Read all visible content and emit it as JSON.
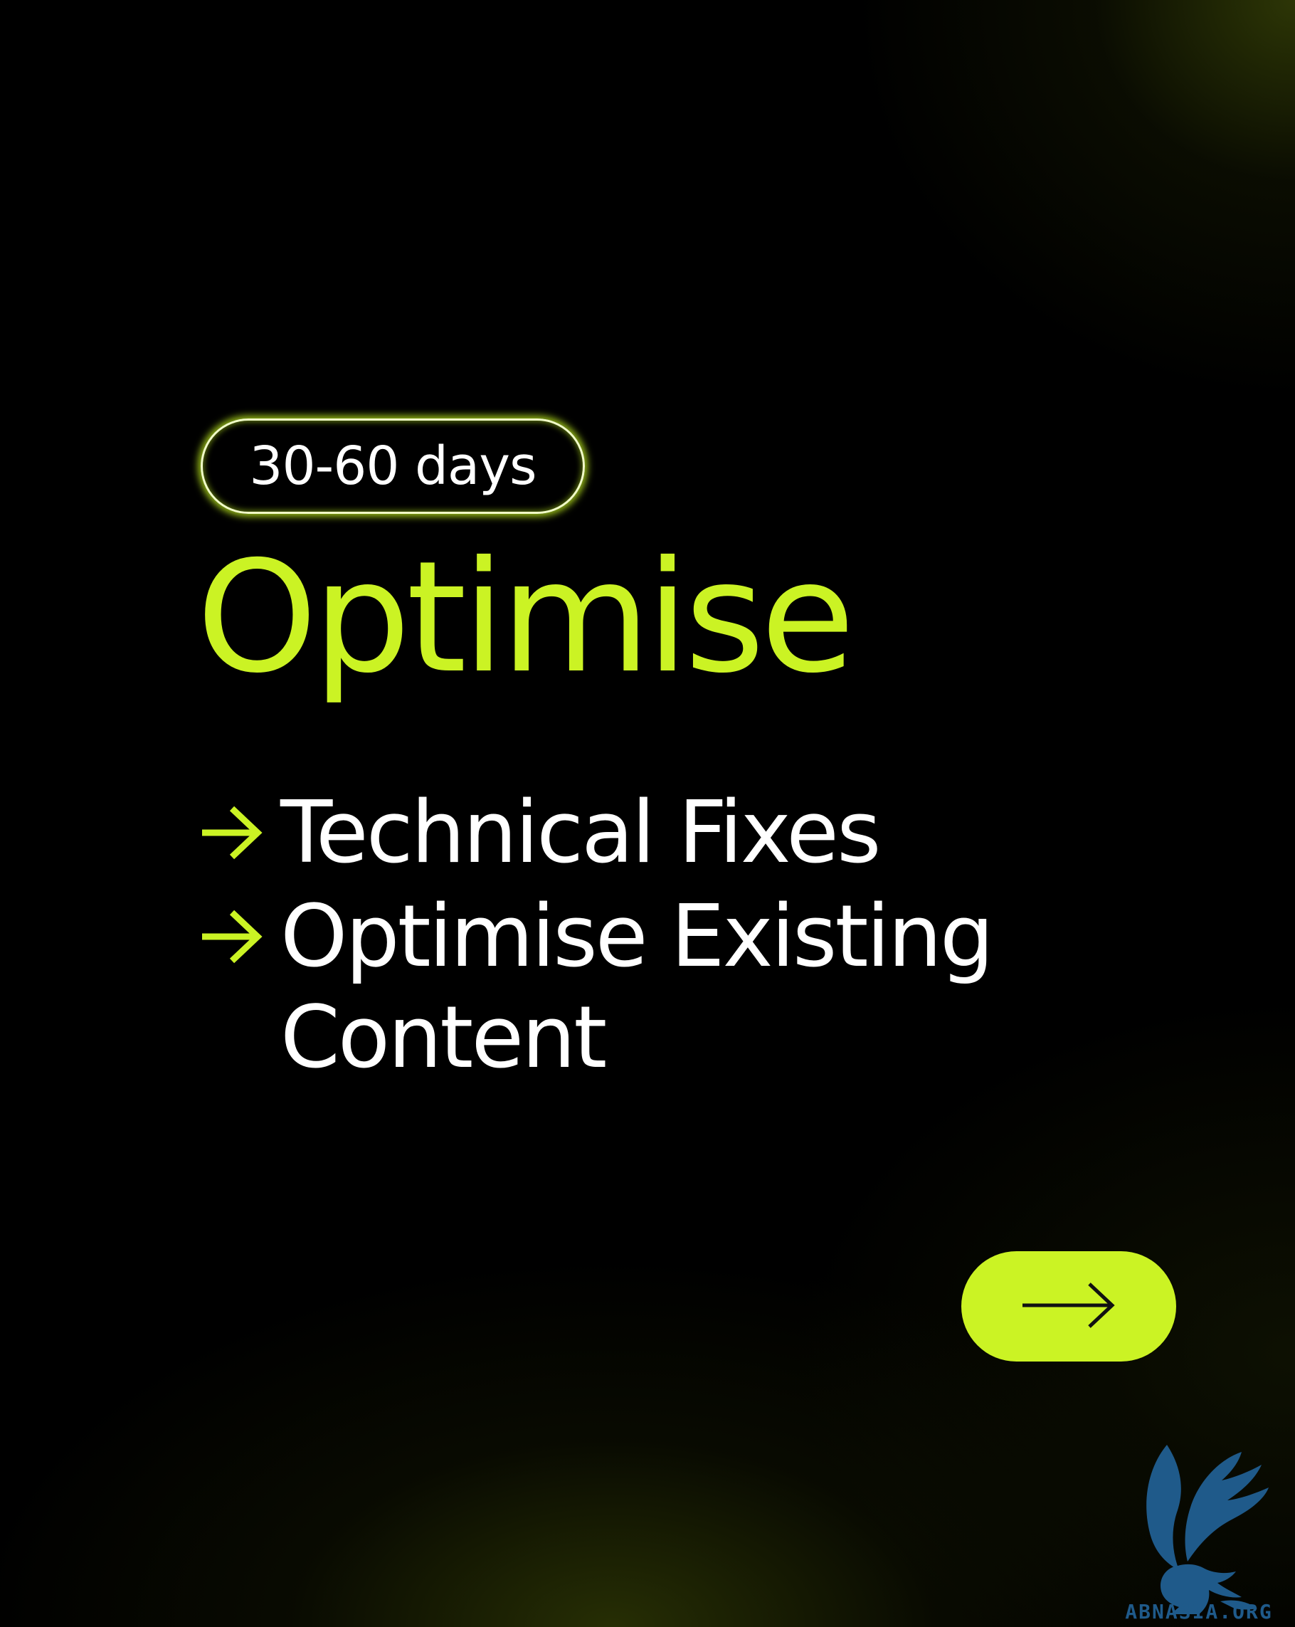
{
  "badge": {
    "label": "30-60 days"
  },
  "title": "Optimise",
  "items": [
    {
      "label": "Technical Fixes"
    },
    {
      "label": "Optimise Existing Content"
    }
  ],
  "next_button": {
    "icon": "arrow-right-icon"
  },
  "watermark": {
    "text": "ABNASIA.ORG"
  },
  "colors": {
    "accent": "#cbf324",
    "background": "#000000",
    "text": "#ffffff",
    "logo": "#1f5a8a"
  }
}
